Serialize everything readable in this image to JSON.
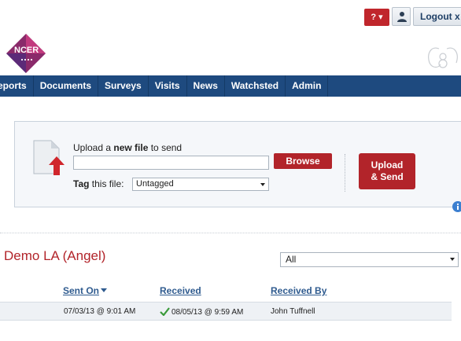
{
  "header": {
    "help_label": "? ▾",
    "logout_label": "Logout x",
    "logo_text": "NCER"
  },
  "nav": {
    "items": [
      "eports",
      "Documents",
      "Surveys",
      "Visits",
      "News",
      "Watchsted",
      "Admin"
    ]
  },
  "upload": {
    "heading_prefix": "Upload a ",
    "heading_bold": "new file",
    "heading_suffix": " to send",
    "browse_label": "Browse",
    "tag_bold": "Tag",
    "tag_suffix": " this file:",
    "tag_value": "Untagged",
    "send_line1": "Upload",
    "send_line2": "& Send"
  },
  "list": {
    "title": "Demo LA (Angel)",
    "filter_value": "All",
    "columns": {
      "sent_on": "Sent On",
      "received": "Received",
      "received_by": "Received By"
    },
    "rows": [
      {
        "sent_on": "07/03/13 @ 9:01 AM",
        "received": "08/05/13 @ 9:59 AM",
        "received_by": "John Tuffnell"
      }
    ]
  },
  "colors": {
    "brand_red": "#b2242a",
    "nav_blue": "#1e4a7f",
    "link_blue": "#2f5b8f",
    "check_green": "#3a9a3a"
  }
}
